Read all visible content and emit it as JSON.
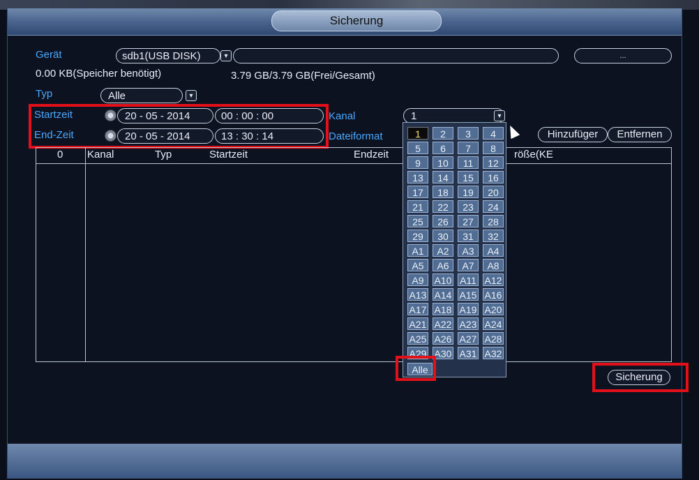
{
  "window": {
    "title": "Sicherung"
  },
  "device": {
    "label": "Gerät",
    "value": "sdb1(USB DISK)",
    "path_value": "",
    "browse_label": "...",
    "required_text": "0.00 KB(Speicher benötigt)",
    "free_text": "3.79 GB/3.79 GB(Frei/Gesamt)"
  },
  "type": {
    "label": "Typ",
    "value": "Alle"
  },
  "start": {
    "label": "Startzeit",
    "day": "20",
    "month": "05",
    "year": "2014",
    "hh": "00",
    "mm": "00",
    "ss": "00"
  },
  "end": {
    "label": "End-Zeit",
    "day": "20",
    "month": "05",
    "year": "2014",
    "hh": "13",
    "mm": "30",
    "ss": "14"
  },
  "sep": {
    "date": "-",
    "time": ":"
  },
  "channel": {
    "label": "Kanal",
    "value": "1",
    "options": [
      "1",
      "2",
      "3",
      "4",
      "5",
      "6",
      "7",
      "8",
      "9",
      "10",
      "11",
      "12",
      "13",
      "14",
      "15",
      "16",
      "17",
      "18",
      "19",
      "20",
      "21",
      "22",
      "23",
      "24",
      "25",
      "26",
      "27",
      "28",
      "29",
      "30",
      "31",
      "32",
      "A1",
      "A2",
      "A3",
      "A4",
      "A5",
      "A6",
      "A7",
      "A8",
      "A9",
      "A10",
      "A11",
      "A12",
      "A13",
      "A14",
      "A15",
      "A16",
      "A17",
      "A18",
      "A19",
      "A20",
      "A21",
      "A22",
      "A23",
      "A24",
      "A25",
      "A26",
      "A27",
      "A28",
      "A29",
      "A30",
      "A31",
      "A32"
    ],
    "all_label": "Alle"
  },
  "format": {
    "label": "Dateiformat"
  },
  "buttons": {
    "add": "Hinzufüger",
    "remove": "Entfernen",
    "backup": "Sicherung"
  },
  "table": {
    "count": "0",
    "headers": {
      "channel": "Kanal",
      "type": "Typ",
      "start": "Startzeit",
      "end": "Endzeit",
      "size": "röße(KE"
    }
  },
  "colors": {
    "highlight": "#e3101a",
    "label_blue": "#4aa8ff"
  }
}
